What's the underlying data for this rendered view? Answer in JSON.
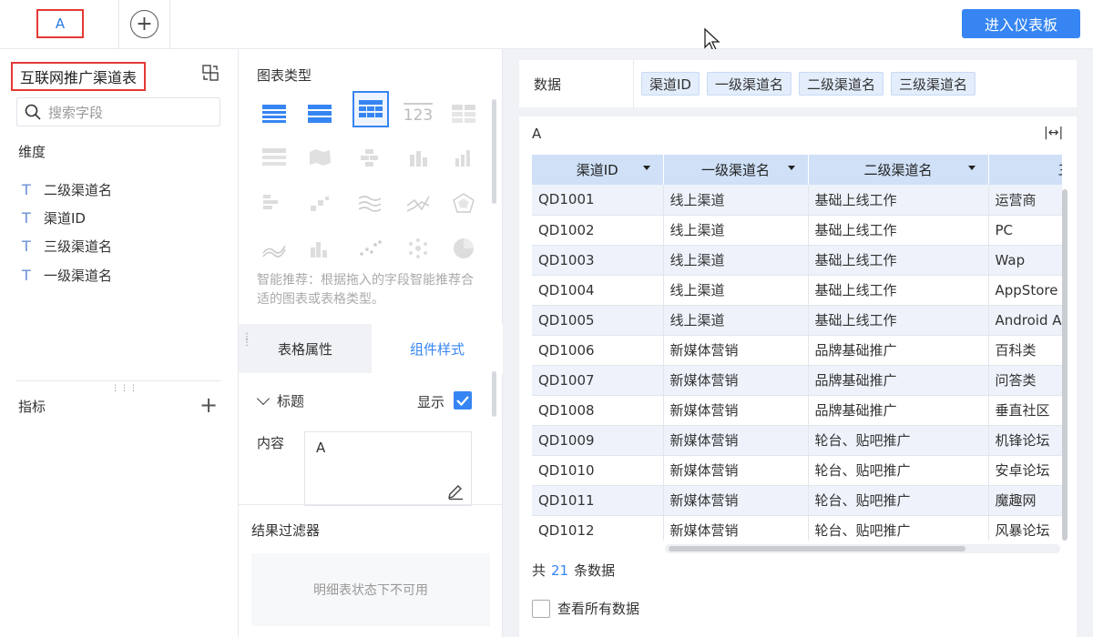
{
  "topbar": {
    "tab_label": "A",
    "enter_dashboard": "进入仪表板"
  },
  "left_panel": {
    "dataset_title": "互联网推广渠道表",
    "search_placeholder": "搜索字段",
    "dimension_label": "维度",
    "dimension_fields": [
      {
        "type": "T",
        "name": "二级渠道名"
      },
      {
        "type": "T",
        "name": "渠道ID"
      },
      {
        "type": "T",
        "name": "三级渠道名"
      },
      {
        "type": "T",
        "name": "一级渠道名"
      }
    ],
    "measure_label": "指标"
  },
  "mid_panel": {
    "chart_type_label": "图表类型",
    "hint": "智能推荐：根据拖入的字段智能推荐合适的图表或表格类型。",
    "tab_properties": "表格属性",
    "tab_style": "组件样式",
    "title_section": "标题",
    "show_label": "显示",
    "content_label": "内容",
    "content_value": "A",
    "filter_label": "结果过滤器",
    "filter_disabled": "明细表状态下不可用"
  },
  "right_panel": {
    "data_label": "数据",
    "data_fields": [
      "渠道ID",
      "一级渠道名",
      "二级渠道名",
      "三级渠道名"
    ],
    "table_title": "A",
    "columns": [
      "渠道ID",
      "一级渠道名",
      "二级渠道名",
      "三"
    ],
    "rows": [
      [
        "QD1001",
        "线上渠道",
        "基础上线工作",
        "运营商"
      ],
      [
        "QD1002",
        "线上渠道",
        "基础上线工作",
        "PC"
      ],
      [
        "QD1003",
        "线上渠道",
        "基础上线工作",
        "Wap"
      ],
      [
        "QD1004",
        "线上渠道",
        "基础上线工作",
        "AppStore"
      ],
      [
        "QD1005",
        "线上渠道",
        "基础上线工作",
        "Android A"
      ],
      [
        "QD1006",
        "新媒体营销",
        "品牌基础推广",
        "百科类"
      ],
      [
        "QD1007",
        "新媒体营销",
        "品牌基础推广",
        "问答类"
      ],
      [
        "QD1008",
        "新媒体营销",
        "品牌基础推广",
        "垂直社区"
      ],
      [
        "QD1009",
        "新媒体营销",
        "轮台、贴吧推广",
        "机锋论坛"
      ],
      [
        "QD1010",
        "新媒体营销",
        "轮台、贴吧推广",
        "安卓论坛"
      ],
      [
        "QD1011",
        "新媒体营销",
        "轮台、贴吧推广",
        "魔趣网"
      ],
      [
        "QD1012",
        "新媒体营销",
        "轮台、贴吧推广",
        "风暴论坛"
      ]
    ],
    "total_prefix": "共",
    "total_count": "21",
    "total_suffix": "条数据",
    "view_all": "查看所有数据"
  },
  "colors": {
    "accent": "#3685f2",
    "highlight_border": "#e53935",
    "header_bg": "#cfe0f7"
  }
}
